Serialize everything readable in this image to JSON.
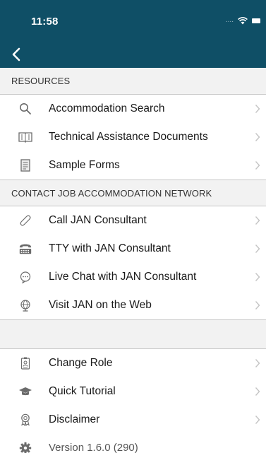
{
  "status_bar": {
    "time": "11:58",
    "signal": "....",
    "icons": [
      "signal-dots-icon",
      "wifi-icon",
      "battery-icon"
    ]
  },
  "nav": {
    "back_icon": "chevron-left-icon"
  },
  "colors": {
    "nav_background": "#0f4f66",
    "section_background": "#f2f2f2",
    "icon_gray": "#6b6b6b",
    "chevron_gray": "#c4c4c4"
  },
  "sections": {
    "resources": {
      "title": "RESOURCES",
      "items": [
        {
          "label": "Accommodation Search",
          "icon": "search-icon"
        },
        {
          "label": "Technical Assistance Documents",
          "icon": "book-icon"
        },
        {
          "label": "Sample Forms",
          "icon": "document-icon"
        }
      ]
    },
    "contact": {
      "title": "CONTACT JOB ACCOMMODATION NETWORK",
      "items": [
        {
          "label": "Call JAN Consultant",
          "icon": "phone-icon"
        },
        {
          "label": "TTY with JAN Consultant",
          "icon": "tty-icon"
        },
        {
          "label": "Live Chat with JAN Consultant",
          "icon": "chat-bubble-icon"
        },
        {
          "label": "Visit JAN on the Web",
          "icon": "globe-icon"
        }
      ]
    },
    "other": {
      "items": [
        {
          "label": "Change Role",
          "icon": "id-badge-icon"
        },
        {
          "label": "Quick Tutorial",
          "icon": "graduation-cap-icon"
        },
        {
          "label": "Disclaimer",
          "icon": "award-ribbon-icon"
        }
      ],
      "version": {
        "label": "Version 1.6.0 (290)",
        "icon": "gear-icon"
      }
    }
  }
}
